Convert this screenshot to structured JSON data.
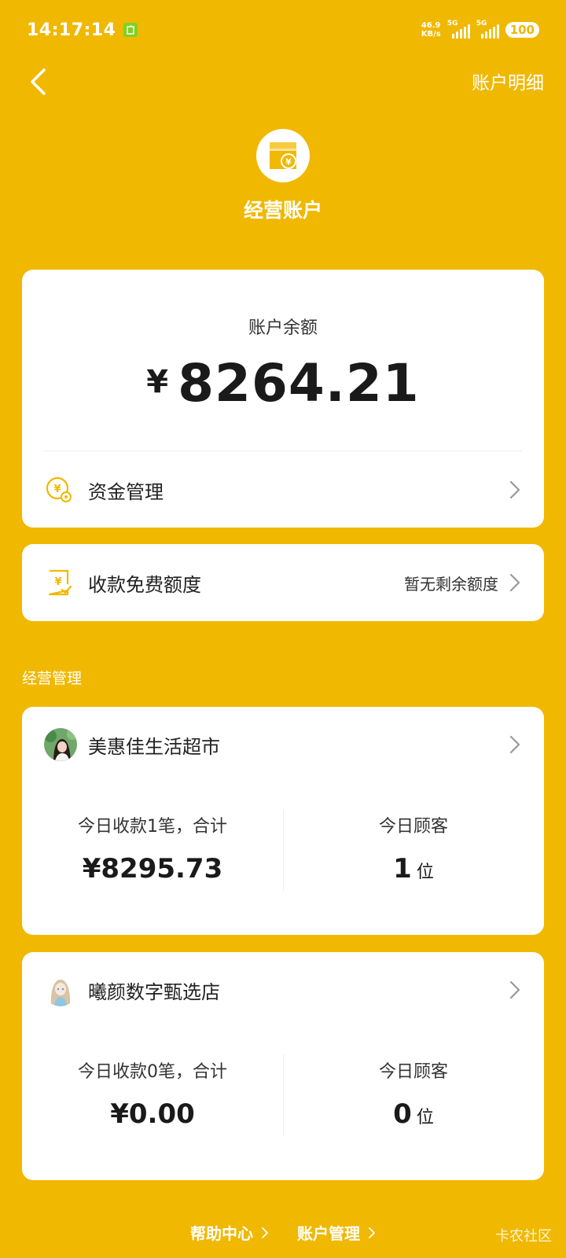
{
  "status_bar": {
    "time": "14:17:14",
    "net_speed_value": "46.9",
    "net_speed_unit": "KB/s",
    "signal_1_label": "5G",
    "signal_2_label": "5G",
    "battery": "100"
  },
  "header": {
    "detail_link": "账户明细",
    "title": "经营账户"
  },
  "balance": {
    "label": "账户余额",
    "currency": "¥",
    "amount": "8264.21"
  },
  "fund_management": {
    "label": "资金管理"
  },
  "fee_quota": {
    "label": "收款免费额度",
    "status": "暂无剩余额度"
  },
  "section_title": "经营管理",
  "stores": [
    {
      "name": "美惠佳生活超市",
      "receipt_label": "今日收款1笔，合计",
      "receipt_amount": "¥8295.73",
      "customer_label": "今日顾客",
      "customer_count": "1",
      "customer_unit": "位"
    },
    {
      "name": "曦颜数字甄选店",
      "receipt_label": "今日收款0笔，合计",
      "receipt_amount": "¥0.00",
      "customer_label": "今日顾客",
      "customer_count": "0",
      "customer_unit": "位"
    }
  ],
  "footer": {
    "help_center": "帮助中心",
    "account_management": "账户管理",
    "watermark": "卡农社区"
  },
  "colors": {
    "background": "#F0B800",
    "accent": "#F0B800",
    "card": "#FFFFFF"
  }
}
